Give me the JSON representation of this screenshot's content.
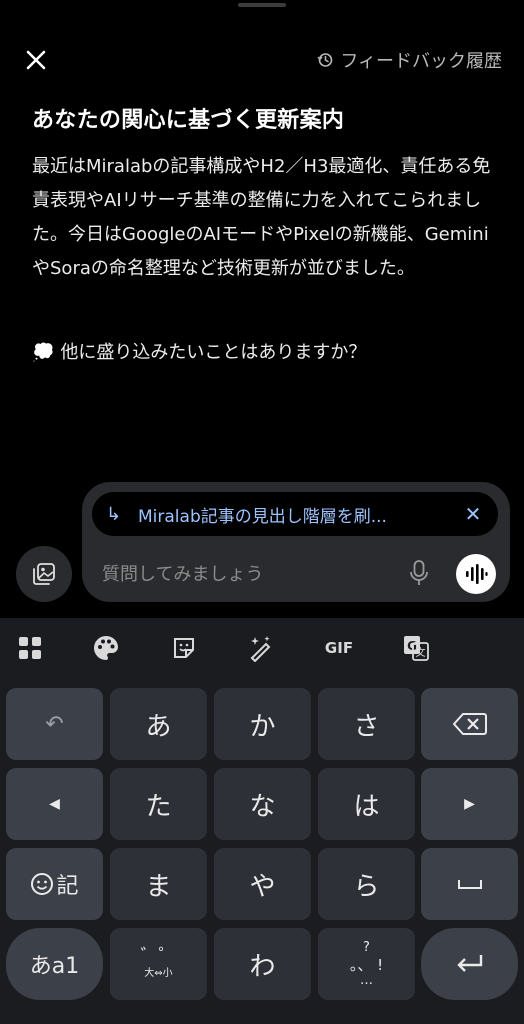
{
  "header": {
    "close_icon": "close-icon",
    "history_label": "フィードバック履歴",
    "history_icon": "history-icon"
  },
  "content": {
    "title": "あなたの関心に基づく更新案内",
    "body": "最近はMiralabの記事構成やH2／H3最適化、責任ある免責表現やAIリサーチ基準の整備に力を入れてこられました。今日はGoogleのAIモードやPixelの新機能、GeminiやSoraの命名整理など技術更新が並びました。",
    "follow_up_icon": "💭",
    "follow_up": "他に盛り込みたいことはありますか？"
  },
  "composer": {
    "quote_text": "Miralab記事の見出し階層を刷...",
    "placeholder": "質問してみましょう",
    "quote_color": "#9cc3ff"
  },
  "keyboard": {
    "toolbar": [
      {
        "name": "apps-grid-icon",
        "label": ""
      },
      {
        "name": "palette-icon",
        "label": ""
      },
      {
        "name": "sticker-icon",
        "label": ""
      },
      {
        "name": "magic-pen-icon",
        "label": ""
      },
      {
        "name": "gif-button",
        "label": "GIF"
      },
      {
        "name": "translate-icon",
        "label": ""
      }
    ],
    "keys": {
      "undo": "↶",
      "a": "あ",
      "ka": "か",
      "sa": "さ",
      "backspace": "⌫",
      "left": "◀",
      "ta": "た",
      "na": "な",
      "ha": "は",
      "right": "▶",
      "emoji_symbol": "記",
      "ma": "ま",
      "ya": "や",
      "ra": "ら",
      "space": "␣",
      "mode": "あa1",
      "dakuten_top": "゛゜",
      "dakuten_bottom": "大⇔小",
      "wa": "わ",
      "punct_top": "?",
      "punct_mid": "。、 !",
      "punct_bottom": "…",
      "enter": "↵"
    }
  }
}
